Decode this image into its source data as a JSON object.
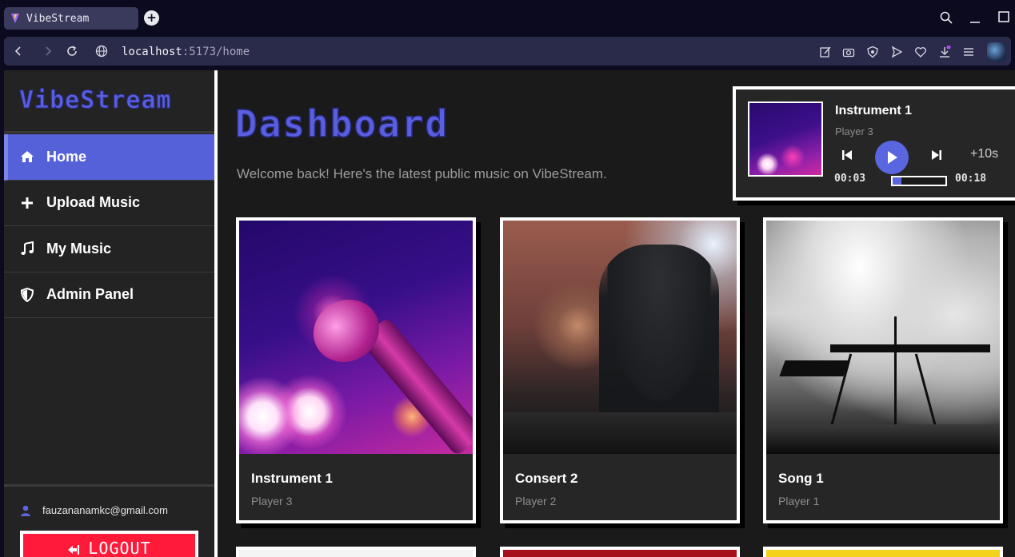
{
  "browser": {
    "tab_title": "VibeStream",
    "url_host": "localhost",
    "url_rest": ":5173/home"
  },
  "sidebar": {
    "logo": "VibeStream",
    "items": [
      {
        "label": "Home",
        "icon": "home-icon",
        "active": true
      },
      {
        "label": "Upload Music",
        "icon": "plus-icon",
        "active": false
      },
      {
        "label": "My Music",
        "icon": "music-note-icon",
        "active": false
      },
      {
        "label": "Admin Panel",
        "icon": "shield-icon",
        "active": false
      }
    ],
    "user_email": "fauzananamkc@gmail.com",
    "logout_label": "LOGOUT"
  },
  "main": {
    "title": "Dashboard",
    "subtitle": "Welcome back! Here's the latest public music on VibeStream."
  },
  "player": {
    "title": "Instrument 1",
    "artist": "Player 3",
    "skip_label": "+10s",
    "current_time": "00:03",
    "duration": "00:18",
    "progress": 0.17
  },
  "cards": [
    {
      "title": "Instrument 1",
      "artist": "Player 3"
    },
    {
      "title": "Consert 2",
      "artist": "Player 2"
    },
    {
      "title": "Song 1",
      "artist": "Player 1"
    }
  ],
  "colors": {
    "accent": "#5a61dc",
    "logout": "#ff1a3a",
    "background": "#1a1a1a"
  }
}
